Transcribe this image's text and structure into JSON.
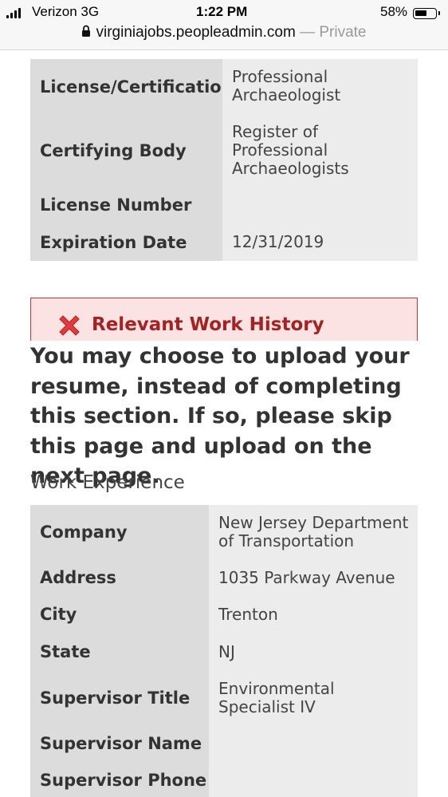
{
  "status_bar": {
    "carrier": "Verizon 3G",
    "time": "1:22 PM",
    "battery": "58%",
    "battery_level": 0.58
  },
  "browser": {
    "url": "virginiajobs.peopleadmin.com",
    "mode": "— Private"
  },
  "license_table": {
    "rows": [
      {
        "label": "License/Certification",
        "value": "Professional Archaeologist"
      },
      {
        "label": "Certifying Body",
        "value": "Register of Professional Archaeologists"
      },
      {
        "label": "License Number",
        "value": ""
      },
      {
        "label": "Expiration Date",
        "value": "12/31/2019"
      }
    ]
  },
  "work_history": {
    "alert_title": "Relevant Work History",
    "notice": "You may choose to upload your resume, instead of completing this section. If so, please skip this page and upload on the next page.",
    "heading": "Work Experience",
    "rows": [
      {
        "label": "Company",
        "value": "New Jersey Department of Transportation"
      },
      {
        "label": "Address",
        "value": "1035 Parkway Avenue"
      },
      {
        "label": "City",
        "value": "Trenton"
      },
      {
        "label": "State",
        "value": "NJ"
      },
      {
        "label": "Supervisor Title",
        "value": "Environmental Specialist IV"
      },
      {
        "label": "Supervisor Name",
        "value": ""
      },
      {
        "label": "Supervisor Phone",
        "value": ""
      }
    ]
  },
  "colors": {
    "alert_background": "#fbe3e3",
    "alert_border": "#c93333",
    "alert_text": "#a52222"
  }
}
